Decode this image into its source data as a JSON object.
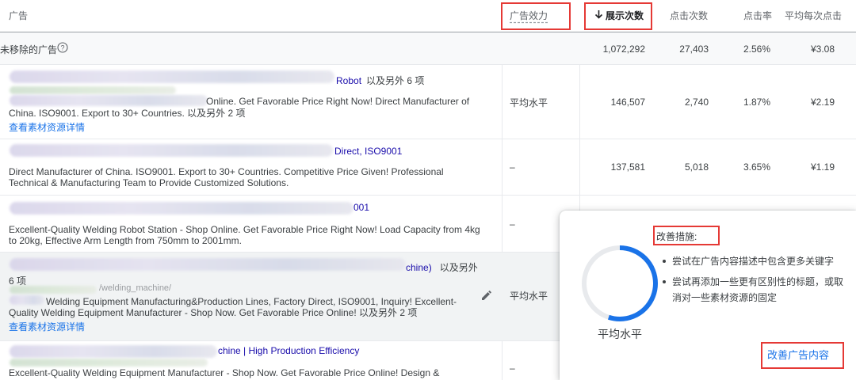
{
  "header": {
    "ad": "广告",
    "ad_effectiveness": "广告效力",
    "impressions": "展示次数",
    "sort_icon": "arrow-down-icon",
    "clicks": "点击次数",
    "ctr": "点击率",
    "avg_cpc": "平均每次点击"
  },
  "summary": {
    "label": "未移除的广告",
    "help_icon": "help-circle-icon",
    "impressions": "1,072,292",
    "clicks": "27,403",
    "ctr": "2.56%",
    "avg_cpc": "¥3.08"
  },
  "rows": [
    {
      "headline_visible": "Robot",
      "headline_more": "以及另外 6 项",
      "description": "Online. Get Favorable Price Right Now! Direct Manufacturer of",
      "description2": "China. ISO9001. Export to 30+ Countries.",
      "description_more": "以及另外 2 项",
      "link": "查看素材资源详情",
      "effectiveness": "平均水平",
      "impressions": "146,507",
      "clicks": "2,740",
      "ctr": "1.87%",
      "avg_cpc": "¥2.19"
    },
    {
      "headline_visible": "Direct, ISO9001",
      "description": "Direct Manufacturer of China. ISO9001. Export to 30+ Countries. Competitive Price Given! Professional",
      "description2": "Technical & Manufacturing Team to Provide Customized Solutions.",
      "effectiveness": "–",
      "impressions": "137,581",
      "clicks": "5,018",
      "ctr": "3.65%",
      "avg_cpc": "¥1.19"
    },
    {
      "headline_visible": "001",
      "description": "Excellent-Quality Welding Robot Station - Shop Online. Get Favorable Price Right Now! Load Capacity from 4kg",
      "description2": "to 20kg, Effective Arm Length from 750mm to 2001mm.",
      "effectiveness": "–"
    },
    {
      "headline_visible": "chine)",
      "headline_more": "以及另外",
      "headline_more2": "6 项",
      "url_fragment": "/welding_machine/",
      "description": "Welding Equipment Manufacturing&Production Lines, Factory Direct, ISO9001, Inquiry! Excellent-",
      "description2": "Quality Welding Equipment Manufacturer - Shop Now. Get Favorable Price Online!",
      "description_more": "以及另外 2 项",
      "link": "查看素材资源详情",
      "effectiveness": "平均水平",
      "edit_icon": "pencil-icon"
    },
    {
      "headline_visible": "chine | High Production Efficiency",
      "description": "Excellent-Quality Welding Equipment Manufacturer - Shop Now. Get Favorable Price Online! Design &",
      "effectiveness": "–"
    }
  ],
  "popup": {
    "ring_label": "平均水平",
    "ring_fraction": 0.55,
    "ring_color": "#1a73e8",
    "ring_track_color": "#e8eaed",
    "tips_title": "改善措施:",
    "tips": [
      "尝试在广告内容描述中包含更多关键字",
      "尝试再添加一些更有区别性的标题，或取消对一些素材资源的固定"
    ],
    "improve_button": "改善广告内容"
  },
  "colors": {
    "link": "#1a73e8",
    "highlight_box": "#e53935"
  }
}
